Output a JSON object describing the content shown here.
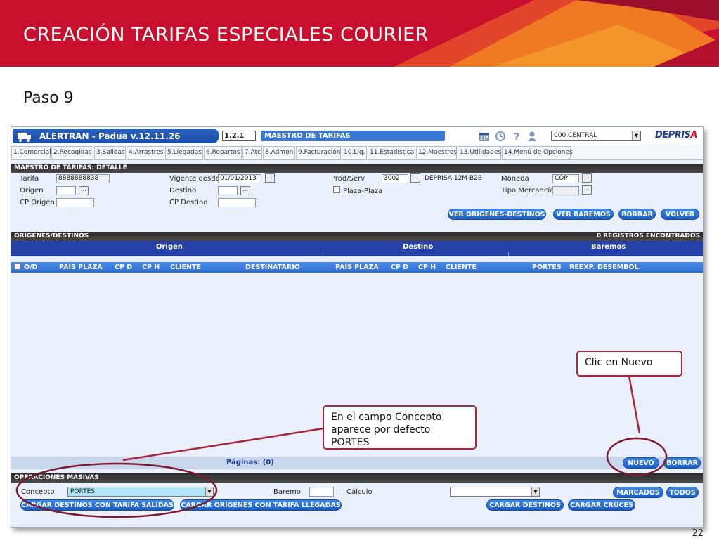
{
  "slide": {
    "title": "CREACIÓN TARIFAS ESPECIALES COURIER",
    "step": "Paso 9",
    "page_number": "22"
  },
  "colors": {
    "header_red": "#c8102e",
    "header_orange": "#f07a24",
    "app_blue": "#1b5fc6",
    "callout_border": "#a8253c"
  },
  "app": {
    "name": "ALERTRAN - Padua  v.12.11.26",
    "code": "1.2.1",
    "module": "MAESTRO DE TARIFAS",
    "center": "000 CENTRAL",
    "logo": "DEPRIS",
    "logo_accent": "A",
    "toolbar_icons": [
      "calendar-icon",
      "clock-icon",
      "help-icon",
      "user-icon"
    ],
    "menu": [
      "1.Comercial",
      "2.Recogidas",
      "3.Salidas",
      "4.Arrastres",
      "5.Llegadas",
      "6.Repartos",
      "7.Atc",
      "8.Admon",
      "9.Facturación",
      "10.Liq.",
      "11.Estadística",
      "12.Maestros",
      "13.Utilidades",
      "14.Menú de Opciones"
    ]
  },
  "detail": {
    "section": "MAESTRO DE TARIFAS: DETALLE",
    "tarifa_label": "Tarifa",
    "tarifa_value": "8888888838",
    "origen_label": "Origen",
    "cp_origen_label": "CP Origen",
    "vigente_label": "Vigente desde",
    "vigente_value": "01/01/2013",
    "destino_label": "Destino",
    "cp_destino_label": "CP Destino",
    "prodserv_label": "Prod/Serv",
    "prodserv_value": "3002",
    "prodserv_desc": "DEPRISA 12M B2B",
    "plaza_label": "Plaza-Plaza",
    "moneda_label": "Moneda",
    "moneda_value": "COP",
    "tipo_label": "Tipo Mercancía",
    "dots": "...",
    "buttons": {
      "ver_origenes": "VER ORIGENES-DESTINOS",
      "ver_baremos": "VER BAREMOS",
      "borrar": "BORRAR",
      "volver": "VOLVER"
    }
  },
  "grid": {
    "section": "ORIGENES/DESTINOS",
    "count": "0 REGISTROS ENCONTRADOS",
    "groups": [
      "Origen",
      "Destino",
      "Baremos"
    ],
    "columns": [
      "O/D",
      "PAÍS PLAZA",
      "CP D",
      "CP H",
      "CLIENTE",
      "DESTINATARIO",
      "PAÍS PLAZA",
      "CP D",
      "CP H",
      "CLIENTE",
      "PORTES",
      "REEXP.",
      "DESEMBOL."
    ],
    "pages": "Páginas: (0)",
    "nuevo": "NUEVO",
    "borrar": "BORRAR"
  },
  "masivas": {
    "section": "OPERACIONES MASIVAS",
    "concepto_label": "Concepto",
    "concepto_value": "PORTES",
    "baremo_label": "Baremo",
    "calculo_label": "Cálculo",
    "marcados": "MARCADOS",
    "todos": "TODOS",
    "cargar_destinos_salidas": "CARGAR DESTINOS CON TARIFA SALIDAS",
    "cargar_origenes_llegadas": "CARGAR ORÍGENES CON TARIFA LLEGADAS",
    "cargar_destinos": "CARGAR DESTINOS",
    "cargar_cruces": "CARGAR CRUCES"
  },
  "callouts": {
    "nuevo": "Clic en Nuevo",
    "concepto": "En el  campo Concepto aparece por defecto PORTES"
  }
}
